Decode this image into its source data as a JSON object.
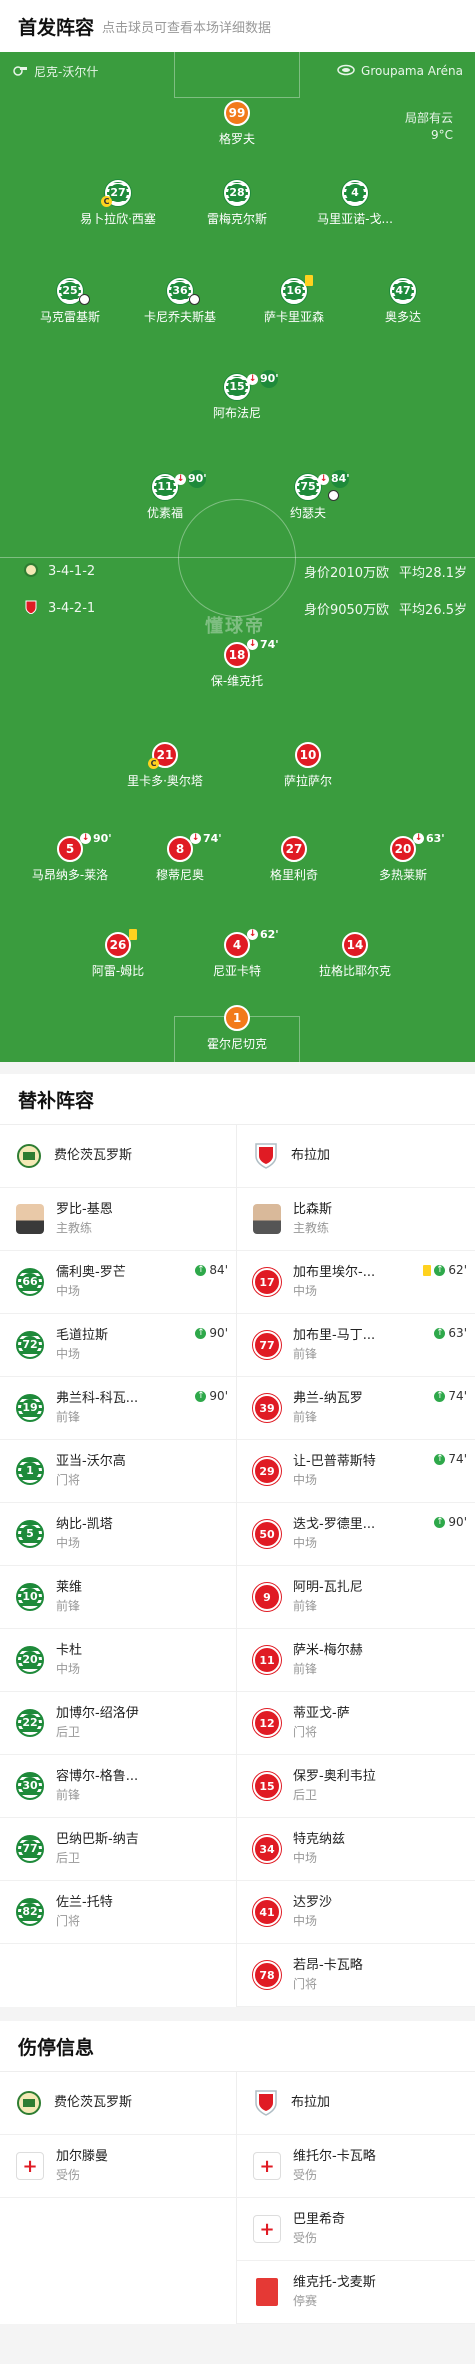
{
  "lineup": {
    "title": "首发阵容",
    "subtitle": "点击球员可查看本场详细数据",
    "referee": "尼克-沃尔什",
    "venue": "Groupama Aréna",
    "weather": "局部有云",
    "temperature": "9°C",
    "watermark": "懂球帝",
    "home_formation": "3-4-1-2",
    "home_value": "身价2010万欧",
    "home_age": "平均28.1岁",
    "away_formation": "3-4-2-1",
    "away_value": "身价9050万欧",
    "away_age": "平均26.5岁",
    "home_players": [
      {
        "num": "99",
        "name": "格罗夫"
      },
      {
        "num": "27",
        "name": "易卜拉欣·西塞"
      },
      {
        "num": "28",
        "name": "雷梅克尔斯"
      },
      {
        "num": "4",
        "name": "马里亚诺-戈..."
      },
      {
        "num": "25",
        "name": "马克雷基斯"
      },
      {
        "num": "36",
        "name": "卡尼乔夫斯基"
      },
      {
        "num": "16",
        "name": "萨卡里亚森"
      },
      {
        "num": "47",
        "name": "奥多达"
      },
      {
        "num": "15",
        "name": "阿布法尼",
        "sub": "90'"
      },
      {
        "num": "11",
        "name": "优素福",
        "sub": "90'"
      },
      {
        "num": "75",
        "name": "约瑟夫",
        "sub": "84'"
      }
    ],
    "away_players": [
      {
        "num": "18",
        "name": "保-维克托",
        "sub": "74'"
      },
      {
        "num": "21",
        "name": "里卡多·奥尔塔"
      },
      {
        "num": "10",
        "name": "萨拉萨尔"
      },
      {
        "num": "5",
        "name": "马昂纳多-莱洛",
        "sub": "90'"
      },
      {
        "num": "8",
        "name": "穆蒂尼奥",
        "sub": "74'"
      },
      {
        "num": "27",
        "name": "格里利奇"
      },
      {
        "num": "20",
        "name": "多热莱斯",
        "sub": "63'"
      },
      {
        "num": "26",
        "name": "阿雷-姆比"
      },
      {
        "num": "4",
        "name": "尼亚卡特",
        "sub": "62'"
      },
      {
        "num": "14",
        "name": "拉格比耶尔克"
      },
      {
        "num": "1",
        "name": "霍尔尼切克"
      }
    ]
  },
  "subs": {
    "title": "替补阵容",
    "home_team": "费伦茨瓦罗斯",
    "away_team": "布拉加",
    "home_coach": {
      "name": "罗比-基恩",
      "role": "主教练"
    },
    "away_coach": {
      "name": "比森斯",
      "role": "主教练"
    },
    "home": [
      {
        "num": "66",
        "name": "儒利奥-罗芒",
        "pos": "中场",
        "in": "84'"
      },
      {
        "num": "72",
        "name": "毛道拉斯",
        "pos": "中场",
        "in": "90'"
      },
      {
        "num": "19",
        "name": "弗兰科-科瓦...",
        "pos": "前锋",
        "in": "90'"
      },
      {
        "num": "1",
        "name": "亚当-沃尔高",
        "pos": "门将"
      },
      {
        "num": "5",
        "name": "纳比-凯塔",
        "pos": "中场"
      },
      {
        "num": "10",
        "name": "莱维",
        "pos": "前锋"
      },
      {
        "num": "20",
        "name": "卡杜",
        "pos": "中场"
      },
      {
        "num": "22",
        "name": "加博尔-绍洛伊",
        "pos": "后卫"
      },
      {
        "num": "30",
        "name": "容博尔-格鲁...",
        "pos": "前锋"
      },
      {
        "num": "77",
        "name": "巴纳巴斯-纳吉",
        "pos": "后卫"
      },
      {
        "num": "82",
        "name": "佐兰-托特",
        "pos": "门将"
      }
    ],
    "away": [
      {
        "num": "17",
        "name": "加布里埃尔-...",
        "pos": "中场",
        "in": "62'",
        "yellow": true
      },
      {
        "num": "77",
        "name": "加布里-马丁...",
        "pos": "前锋",
        "in": "63'"
      },
      {
        "num": "39",
        "name": "弗兰-纳瓦罗",
        "pos": "前锋",
        "in": "74'"
      },
      {
        "num": "29",
        "name": "让-巴普蒂斯特",
        "pos": "中场",
        "in": "74'"
      },
      {
        "num": "50",
        "name": "迭戈-罗德里...",
        "pos": "中场",
        "in": "90'"
      },
      {
        "num": "9",
        "name": "阿明-瓦扎尼",
        "pos": "前锋"
      },
      {
        "num": "11",
        "name": "萨米-梅尔赫",
        "pos": "前锋"
      },
      {
        "num": "12",
        "name": "蒂亚戈-萨",
        "pos": "门将"
      },
      {
        "num": "15",
        "name": "保罗-奥利韦拉",
        "pos": "后卫"
      },
      {
        "num": "34",
        "name": "特克纳兹",
        "pos": "中场"
      },
      {
        "num": "41",
        "name": "达罗沙",
        "pos": "中场"
      },
      {
        "num": "78",
        "name": "若昂-卡瓦略",
        "pos": "门将"
      }
    ]
  },
  "injuries": {
    "title": "伤停信息",
    "home_team": "费伦茨瓦罗斯",
    "away_team": "布拉加",
    "home": [
      {
        "name": "加尔滕曼",
        "status": "受伤"
      }
    ],
    "away": [
      {
        "name": "维托尔-卡瓦略",
        "status": "受伤"
      },
      {
        "name": "巴里希奇",
        "status": "受伤"
      },
      {
        "name": "维克托-戈麦斯",
        "status": "停赛"
      }
    ]
  },
  "colors": {
    "pitch": "#3a9c3e",
    "home": "#1e8a3a",
    "away": "#e01b24",
    "gk_home": "#f27a1a"
  }
}
